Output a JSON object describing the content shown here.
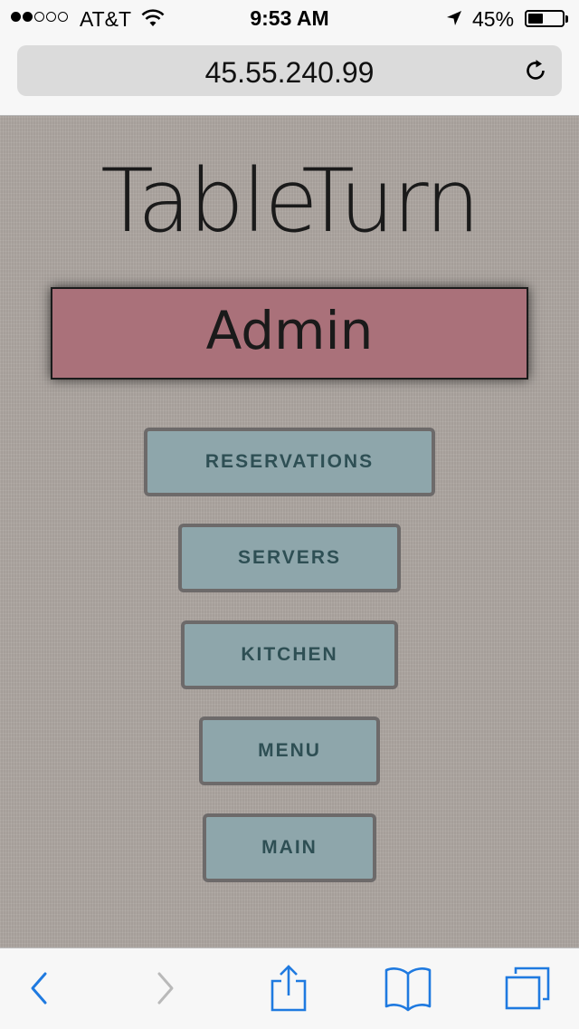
{
  "status_bar": {
    "carrier": "AT&T",
    "time": "9:53 AM",
    "battery_percent": "45%",
    "battery_level": 0.45,
    "signal_bars_filled": 2,
    "signal_bars_total": 5,
    "icons": [
      "wifi-icon",
      "location-arrow-icon",
      "battery-icon"
    ]
  },
  "browser": {
    "url": "45.55.240.99",
    "reload_icon": "reload-icon",
    "toolbar_icons": [
      "back-icon",
      "forward-icon",
      "share-icon",
      "bookmarks-icon",
      "tabs-icon"
    ]
  },
  "page": {
    "app_title": "TableTurn",
    "section_title": "Admin",
    "nav_buttons": [
      {
        "label": "RESERVATIONS"
      },
      {
        "label": "SERVERS"
      },
      {
        "label": "KITCHEN"
      },
      {
        "label": "MENU"
      },
      {
        "label": "MAIN"
      }
    ]
  },
  "colors": {
    "background": "#aea7a2",
    "admin_banner": "#aa717a",
    "button_fill": "#8ea6ab",
    "button_border": "#6d6a6a",
    "button_text": "#2e4f54",
    "ios_blue": "#1f7ae0"
  }
}
